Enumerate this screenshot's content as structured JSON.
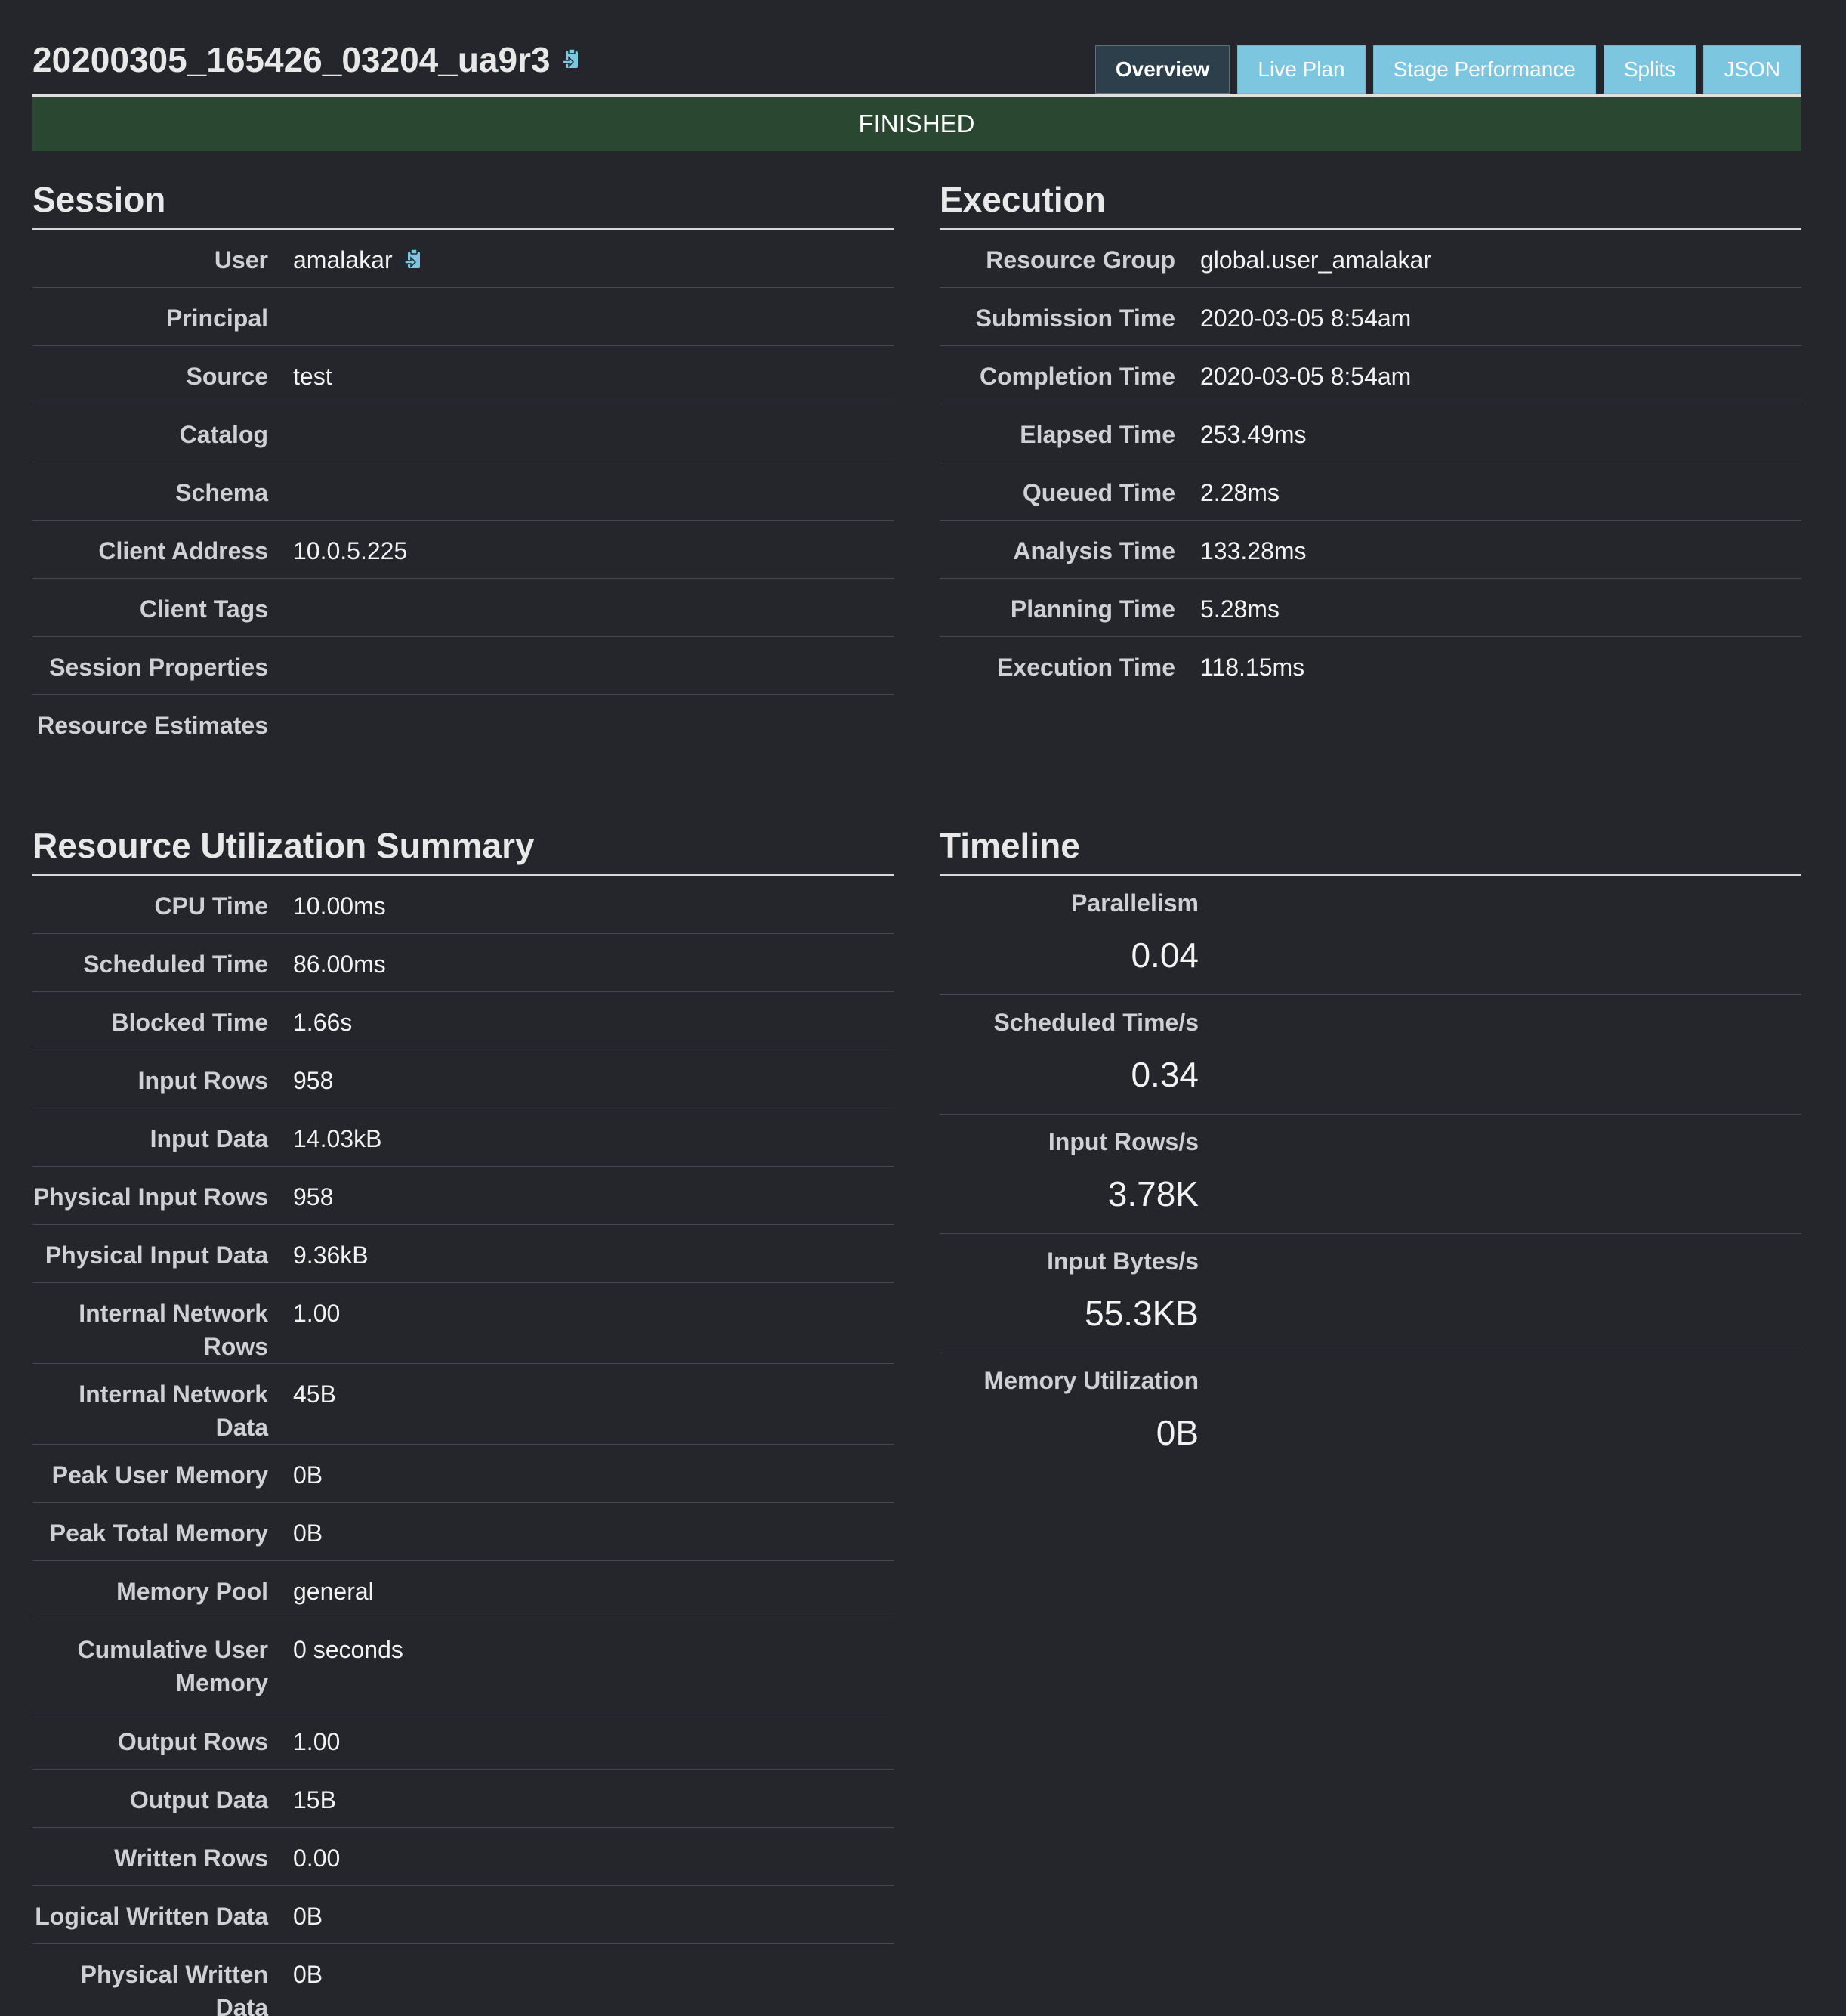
{
  "header": {
    "query_id": "20200305_165426_03204_ua9r3",
    "copy_icon": "clipboard-icon",
    "tabs": [
      {
        "label": "Overview",
        "active": true
      },
      {
        "label": "Live Plan",
        "active": false
      },
      {
        "label": "Stage Performance",
        "active": false
      },
      {
        "label": "Splits",
        "active": false
      },
      {
        "label": "JSON",
        "active": false
      }
    ],
    "state": "FINISHED",
    "state_color": "#2a4731"
  },
  "session": {
    "title": "Session",
    "rows": [
      {
        "label": "User",
        "value": "amalakar"
      },
      {
        "label": "Principal",
        "value": ""
      },
      {
        "label": "Source",
        "value": "test"
      },
      {
        "label": "Catalog",
        "value": ""
      },
      {
        "label": "Schema",
        "value": ""
      },
      {
        "label": "Client Address",
        "value": "10.0.5.225"
      },
      {
        "label": "Client Tags",
        "value": ""
      },
      {
        "label": "Session Properties",
        "value": ""
      },
      {
        "label": "Resource Estimates",
        "value": ""
      }
    ]
  },
  "execution": {
    "title": "Execution",
    "rows": [
      {
        "label": "Resource Group",
        "value": "global.user_amalakar"
      },
      {
        "label": "Submission Time",
        "value": "2020-03-05 8:54am"
      },
      {
        "label": "Completion Time",
        "value": "2020-03-05 8:54am"
      },
      {
        "label": "Elapsed Time",
        "value": "253.49ms"
      },
      {
        "label": "Queued Time",
        "value": "2.28ms"
      },
      {
        "label": "Analysis Time",
        "value": "133.28ms"
      },
      {
        "label": "Planning Time",
        "value": "5.28ms"
      },
      {
        "label": "Execution Time",
        "value": "118.15ms"
      }
    ]
  },
  "resource_summary": {
    "title": "Resource Utilization Summary",
    "rows": [
      {
        "label": "CPU Time",
        "value": "10.00ms"
      },
      {
        "label": "Scheduled Time",
        "value": "86.00ms"
      },
      {
        "label": "Blocked Time",
        "value": "1.66s"
      },
      {
        "label": "Input Rows",
        "value": "958"
      },
      {
        "label": "Input Data",
        "value": "14.03kB"
      },
      {
        "label": "Physical Input Rows",
        "value": "958"
      },
      {
        "label": "Physical Input Data",
        "value": "9.36kB"
      },
      {
        "label": "Internal Network Rows",
        "value": "1.00"
      },
      {
        "label": "Internal Network Data",
        "value": "45B"
      },
      {
        "label": "Peak User Memory",
        "value": "0B"
      },
      {
        "label": "Peak Total Memory",
        "value": "0B"
      },
      {
        "label": "Memory Pool",
        "value": "general"
      },
      {
        "label": "Cumulative User Memory",
        "value": "0 seconds"
      },
      {
        "label": "Output Rows",
        "value": "1.00"
      },
      {
        "label": "Output Data",
        "value": "15B"
      },
      {
        "label": "Written Rows",
        "value": "0.00"
      },
      {
        "label": "Logical Written Data",
        "value": "0B"
      },
      {
        "label": "Physical Written Data",
        "value": "0B"
      }
    ]
  },
  "timeline": {
    "title": "Timeline",
    "rows": [
      {
        "label": "Parallelism",
        "value": "0.04"
      },
      {
        "label": "Scheduled Time/s",
        "value": "0.34"
      },
      {
        "label": "Input Rows/s",
        "value": "3.78K"
      },
      {
        "label": "Input Bytes/s",
        "value": "55.3KB"
      },
      {
        "label": "Memory Utilization",
        "value": "0B"
      }
    ]
  }
}
